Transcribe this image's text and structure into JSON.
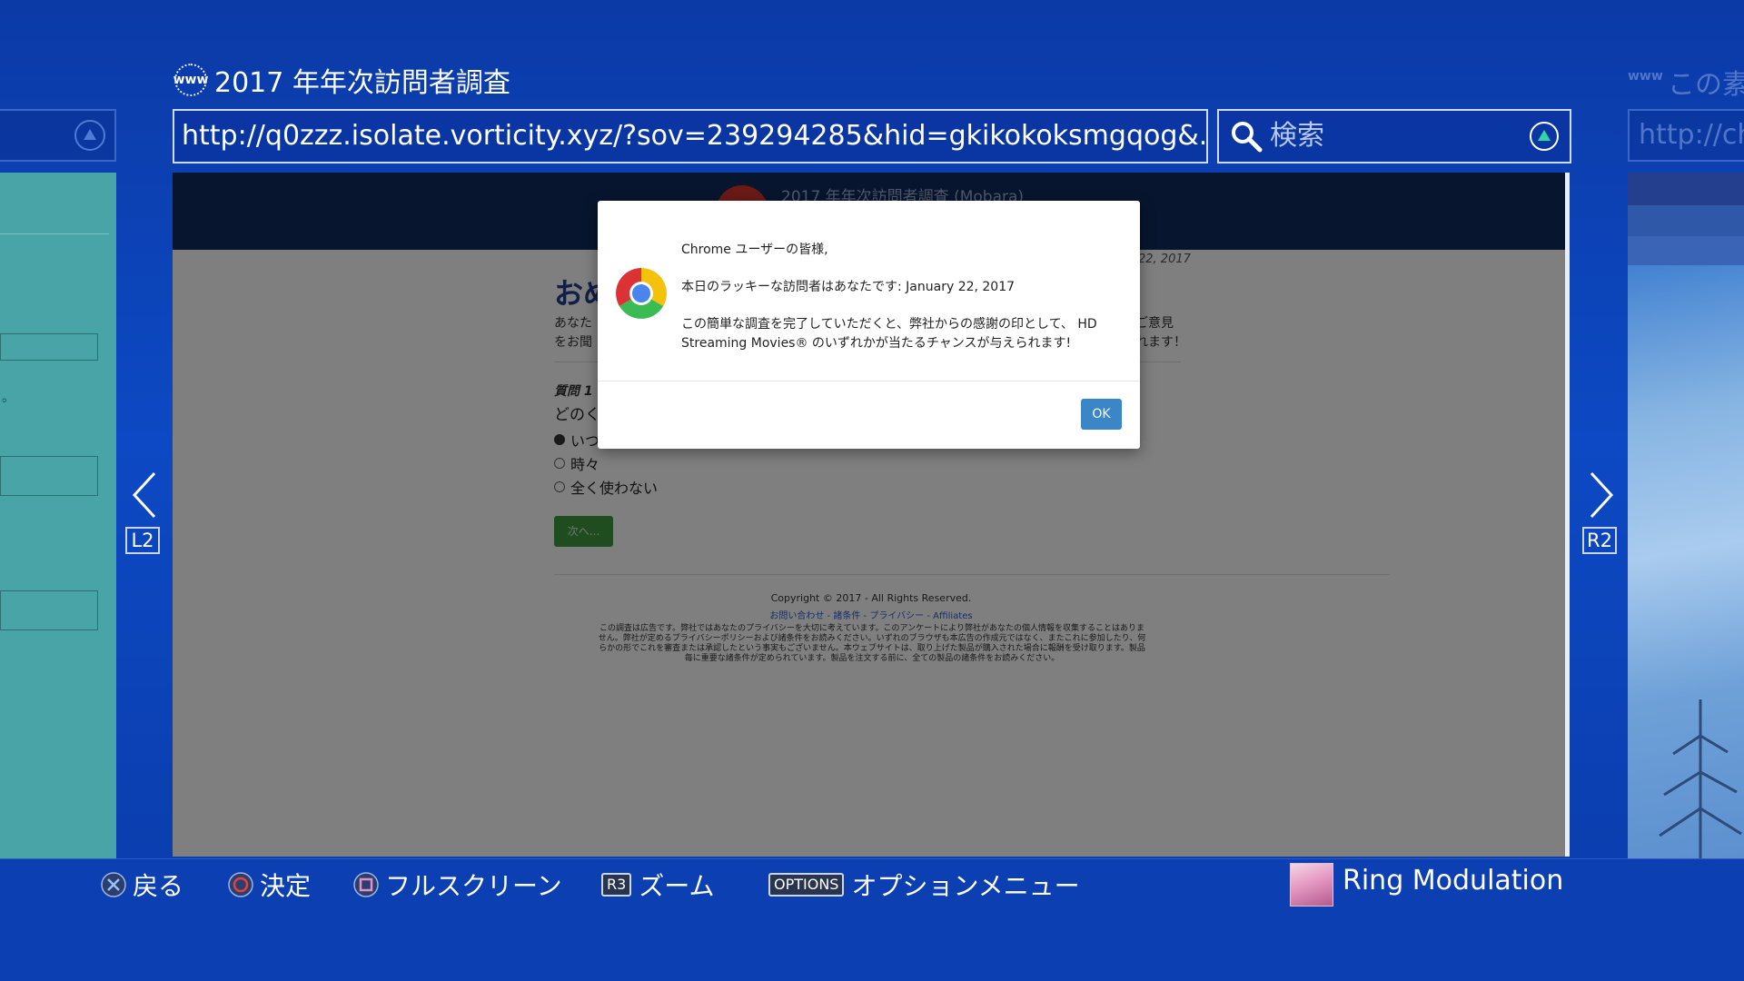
{
  "browser": {
    "tab_title": "2017 年年次訪問者調査",
    "url": "http://q0zzz.isolate.vorticity.xyz/?sov=239294285&hid=gkikokoksmgqog&...",
    "search_placeholder": "検索",
    "next_tab_title": "この素",
    "next_tab_url": "http://ch",
    "www_label": "www",
    "left_nav_key": "L2",
    "right_nav_key": "R2"
  },
  "webpage": {
    "header_title": "2017 年年次訪問者調査 (Mobara)",
    "date": "22, 2017",
    "heading": "おめ",
    "intro_line1": "あなた",
    "intro_line2": "をお聞",
    "intro_right1": "ご意見",
    "intro_right2": "れます！",
    "question_label": "質問 1",
    "question_text": "どのく",
    "options": [
      {
        "label": "いつ",
        "selected": true
      },
      {
        "label": "時々",
        "selected": false
      },
      {
        "label": "全く使わない",
        "selected": false
      }
    ],
    "next_button": "次へ...",
    "copyright": "Copyright © 2017 - All Rights Reserved.",
    "footer_links": "お問い合わせ - 諸条件 - プライバシー - Affiliates",
    "disclaimer": "この調査は広告です。弊社ではあなたのプライバシーを大切に考えています。このアンケートにより弊社があなたの個人情報を収集することはありません。弊社が定めるプライバシーポリシーおよび諸条件をお読みください。いずれのブラウザも本広告の作成元ではなく、またこれに参加したり、何らかの形でこれを審査または承認したという事実もございません。本ウェブサイトは、取り上げた製品が購入された場合に報酬を受け取ります。製品毎に重要な諸条件が定められています。製品を注文する前に、全ての製品の諸条件をお読みください。"
  },
  "alert": {
    "greeting": "Chrome ユーザーの皆様,",
    "line1": "本日のラッキーな訪問者はあなたです: January 22, 2017",
    "line2": "この簡単な調査を完了していただくと、弊社からの感謝の印として、 HD",
    "line3": "Streaming Movies® のいずれかが当たるチャンスが与えられます!",
    "ok_label": "OK"
  },
  "bottom_bar": {
    "back_label": "戻る",
    "confirm_label": "決定",
    "fullscreen_label": "フルスクリーン",
    "r3_key": "R3",
    "zoom_label": "ズーム",
    "options_key": "OPTIONS",
    "options_label": "オプションメニュー",
    "user_name": "Ring Modulation"
  },
  "colors": {
    "background": "#0b3aa6",
    "triangle": "#2fd8a5",
    "circle": "#e8403a",
    "square": "#e58fc4",
    "cross": "#9ec1f2",
    "ok_button": "#3b86c6",
    "next_button": "#3e9a3e"
  }
}
